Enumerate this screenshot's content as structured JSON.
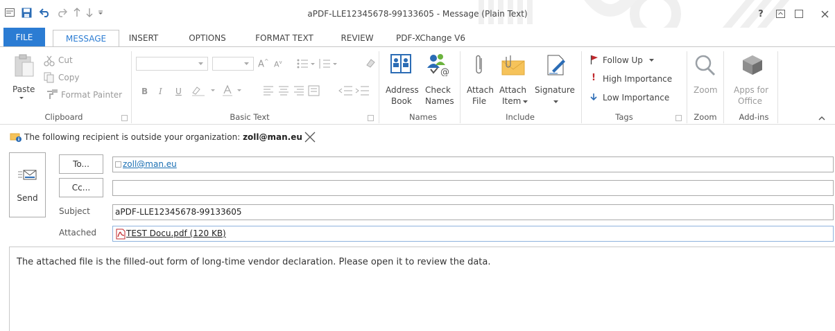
{
  "window": {
    "title": "aPDF-LLE12345678-99133605 - Message (Plain Text)",
    "help": "?"
  },
  "tabs": [
    {
      "id": "file",
      "label": "FILE"
    },
    {
      "id": "message",
      "label": "MESSAGE"
    },
    {
      "id": "insert",
      "label": "INSERT"
    },
    {
      "id": "options",
      "label": "OPTIONS"
    },
    {
      "id": "format",
      "label": "FORMAT TEXT"
    },
    {
      "id": "review",
      "label": "REVIEW"
    },
    {
      "id": "pdfx",
      "label": "PDF-XChange V6"
    }
  ],
  "ribbon": {
    "clipboard": {
      "label": "Clipboard",
      "paste": "Paste",
      "cut": "Cut",
      "copy": "Copy",
      "format_painter": "Format Painter"
    },
    "basic_text": {
      "label": "Basic Text",
      "bold": "B",
      "italic": "I",
      "underline": "U"
    },
    "names": {
      "label": "Names",
      "address_book_1": "Address",
      "address_book_2": "Book",
      "check_names_1": "Check",
      "check_names_2": "Names"
    },
    "include": {
      "label": "Include",
      "attach_file_1": "Attach",
      "attach_file_2": "File",
      "attach_item_1": "Attach",
      "attach_item_2": "Item",
      "signature": "Signature"
    },
    "tags": {
      "label": "Tags",
      "follow_up": "Follow Up",
      "high": "High Importance",
      "low": "Low Importance"
    },
    "zoom": {
      "label": "Zoom",
      "zoom": "Zoom"
    },
    "addins": {
      "label": "Add-ins",
      "apps_1": "Apps for",
      "apps_2": "Office"
    }
  },
  "infobar": {
    "prefix": "The following recipient is outside your organization: ",
    "email": "zoll@man.eu"
  },
  "compose": {
    "send": "Send",
    "to_button": "To...",
    "cc_button": "Cc...",
    "to_value": "zoll@man.eu",
    "cc_value": "",
    "subject_label": "Subject",
    "subject_value": "aPDF-LLE12345678-99133605",
    "attached_label": "Attached",
    "attachment": "TEST Docu.pdf (120 KB)"
  },
  "body": {
    "text": "The attached file is the filled-out form of long-time vendor declaration. Please open it to review the data."
  },
  "colors": {
    "accent": "#2b7cd3",
    "pdf_red": "#c0282d",
    "link": "#1a6fb3"
  }
}
